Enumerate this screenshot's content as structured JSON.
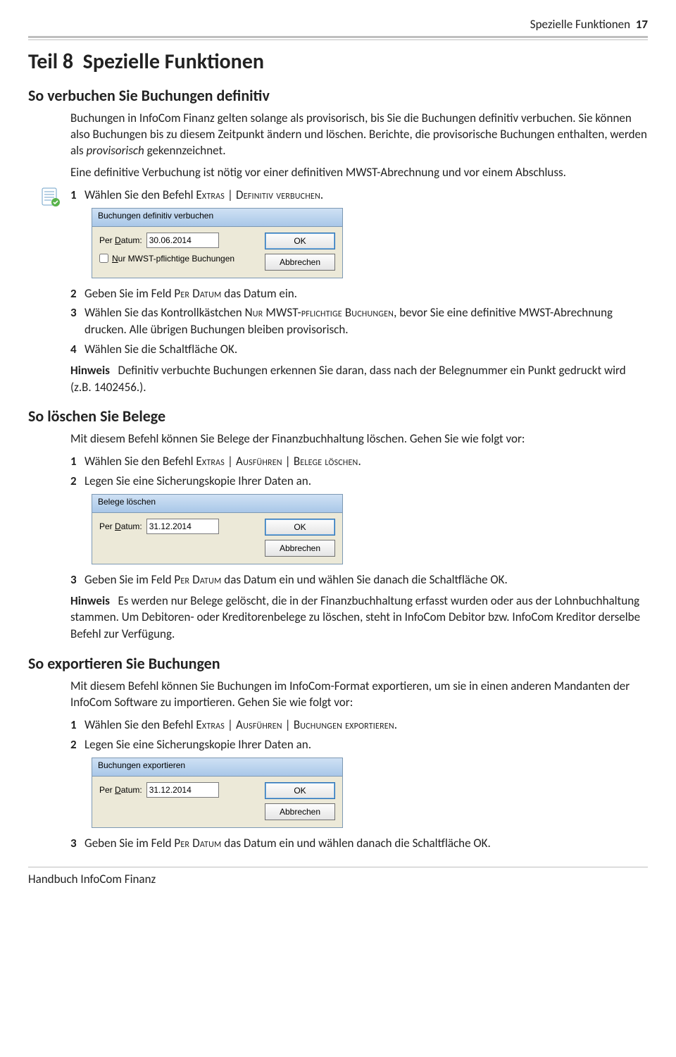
{
  "header": {
    "section": "Spezielle Funktionen",
    "page": "17"
  },
  "part": {
    "prefix": "Teil 8",
    "title": "Spezielle Funktionen"
  },
  "sec1": {
    "heading": "So verbuchen Sie Buchungen definitiv",
    "p1": "Buchungen in InfoCom Finanz gelten solange als provisorisch, bis Sie die Buchungen definitiv verbuchen. Sie können also Buchungen bis zu diesem Zeitpunkt ändern und löschen. Berichte, die provisorische Buchungen enthalten, werden als ",
    "p1_em": "provisorisch",
    "p1_rest": " gekennzeichnet.",
    "p2": "Eine definitive Verbuchung ist nötig vor einer definitiven MWST-Abrechnung und vor einem Abschluss.",
    "step1_pre": "Wählen Sie den Befehl ",
    "step1_sc": "Extras | Definitiv verbuchen",
    "step1_post": ".",
    "dlg": {
      "title": "Buchungen definitiv verbuchen",
      "per_label": "Per Datum:",
      "per_label_u": "D",
      "date": "30.06.2014",
      "chk_label": "Nur MWST-pflichtige Buchungen",
      "chk_u": "N",
      "ok": "OK",
      "cancel": "Abbrechen"
    },
    "step2_pre": "Geben Sie im Feld ",
    "step2_sc": "Per Datum",
    "step2_post": " das Datum ein.",
    "step3_pre": "Wählen Sie das Kontrollkästchen ",
    "step3_sc": "Nur MWST-pflichtige Buchungen",
    "step3_post": ", bevor Sie eine definitive MWST-Abrechnung drucken. Alle übrigen Buchungen bleiben provisorisch.",
    "step4": "Wählen Sie die Schaltfläche OK.",
    "hinweis_lbl": "Hinweis",
    "hinweis_txt": "Definitiv verbuchte Buchungen erkennen Sie daran, dass nach der Belegnummer ein Punkt gedruckt wird (z.B. 1402456.)."
  },
  "sec2": {
    "heading": "So löschen Sie Belege",
    "p1": "Mit diesem Befehl können Sie Belege der Finanzbuchhaltung löschen. Gehen Sie wie folgt vor:",
    "step1_pre": "Wählen Sie den Befehl ",
    "step1_sc": "Extras | Ausführen | Belege löschen",
    "step1_post": ".",
    "step2": "Legen Sie eine Sicherungskopie Ihrer Daten an.",
    "dlg": {
      "title": "Belege löschen",
      "per_label": "Per Datum:",
      "per_label_u": "D",
      "date": "31.12.2014",
      "ok": "OK",
      "cancel": "Abbrechen"
    },
    "step3_pre": "Geben Sie im Feld ",
    "step3_sc": "Per Datum",
    "step3_post": " das Datum ein und wählen Sie danach die Schaltfläche OK.",
    "hinweis_lbl": "Hinweis",
    "hinweis_txt": "Es werden nur Belege gelöscht, die in der Finanzbuchhaltung erfasst wurden oder aus der Lohnbuchhaltung stammen. Um Debitoren- oder Kreditorenbelege zu löschen, steht in InfoCom Debitor bzw. InfoCom Kreditor derselbe Befehl zur Verfügung."
  },
  "sec3": {
    "heading": "So exportieren Sie Buchungen",
    "p1": "Mit diesem Befehl können Sie Buchungen im InfoCom-Format exportieren, um sie in einen anderen Mandanten der InfoCom Software zu importieren. Gehen Sie wie folgt vor:",
    "step1_pre": "Wählen Sie den Befehl ",
    "step1_sc": "Extras | Ausführen | Buchungen exportieren",
    "step1_post": ".",
    "step2": "Legen Sie eine Sicherungskopie Ihrer Daten an.",
    "dlg": {
      "title": "Buchungen exportieren",
      "per_label": "Per Datum:",
      "per_label_u": "D",
      "date": "31.12.2014",
      "ok": "OK",
      "cancel": "Abbrechen"
    },
    "step3_pre": "Geben Sie im Feld ",
    "step3_sc": "Per Datum",
    "step3_post": " das Datum ein und wählen danach die Schaltfläche OK."
  },
  "footer": "Handbuch InfoCom Finanz",
  "nums": {
    "n1": "1",
    "n2": "2",
    "n3": "3",
    "n4": "4"
  }
}
